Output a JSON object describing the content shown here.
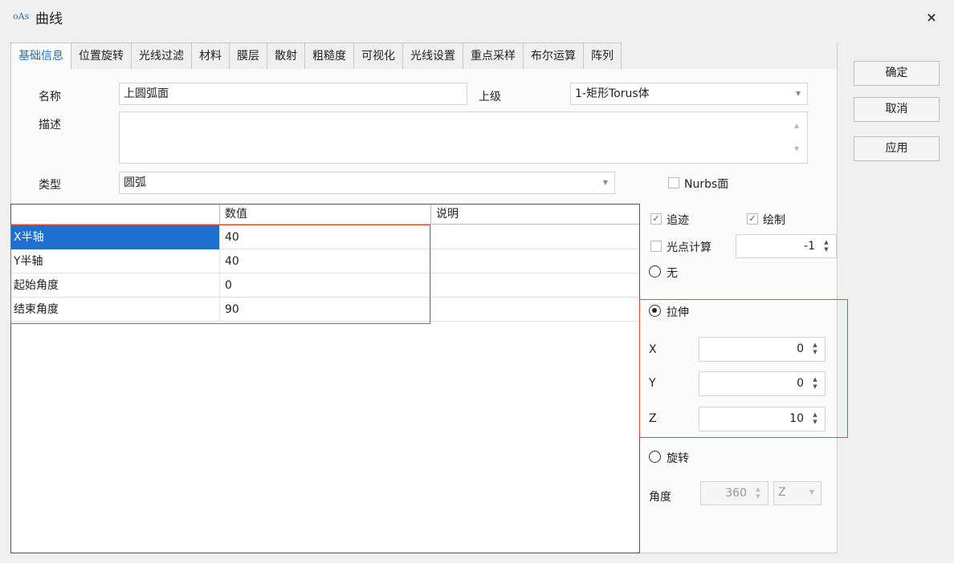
{
  "window": {
    "logo_text": "oAs",
    "title": "曲线",
    "close_glyph": "×"
  },
  "tabs": [
    "基础信息",
    "位置旋转",
    "光线过滤",
    "材料",
    "膜层",
    "散射",
    "粗糙度",
    "可视化",
    "光线设置",
    "重点采样",
    "布尔运算",
    "阵列"
  ],
  "form": {
    "name_label": "名称",
    "name_value": "上圆弧面",
    "parent_label": "上级",
    "parent_value": "1-矩形Torus体",
    "desc_label": "描述",
    "desc_value": "",
    "type_label": "类型",
    "type_value": "圆弧",
    "nurbs_label": "Nurbs面"
  },
  "grid": {
    "columns": [
      "",
      "数值",
      "说明"
    ],
    "rows": [
      {
        "name": "X半轴",
        "value": "40",
        "desc": ""
      },
      {
        "name": "Y半轴",
        "value": "40",
        "desc": ""
      },
      {
        "name": "起始角度",
        "value": "0",
        "desc": ""
      },
      {
        "name": "结束角度",
        "value": "90",
        "desc": ""
      }
    ]
  },
  "options": {
    "trace_label": "追迹",
    "trace_checked": true,
    "draw_label": "绘制",
    "draw_checked": true,
    "spot_label": "光点计算",
    "spot_checked": false,
    "spot_value": "-1",
    "none_label": "无",
    "extrude_label": "拉伸",
    "x_label": "X",
    "x_value": "0",
    "y_label": "Y",
    "y_value": "0",
    "z_label": "Z",
    "z_value": "10",
    "rotate_label": "旋转",
    "angle_label": "角度",
    "angle_value": "360",
    "axis_value": "Z"
  },
  "buttons": {
    "ok": "确定",
    "cancel": "取消",
    "apply": "应用"
  },
  "colors": {
    "accent": "#1e73be",
    "selection": "#1e6fd0",
    "highlight_box": "#e24a2c"
  }
}
